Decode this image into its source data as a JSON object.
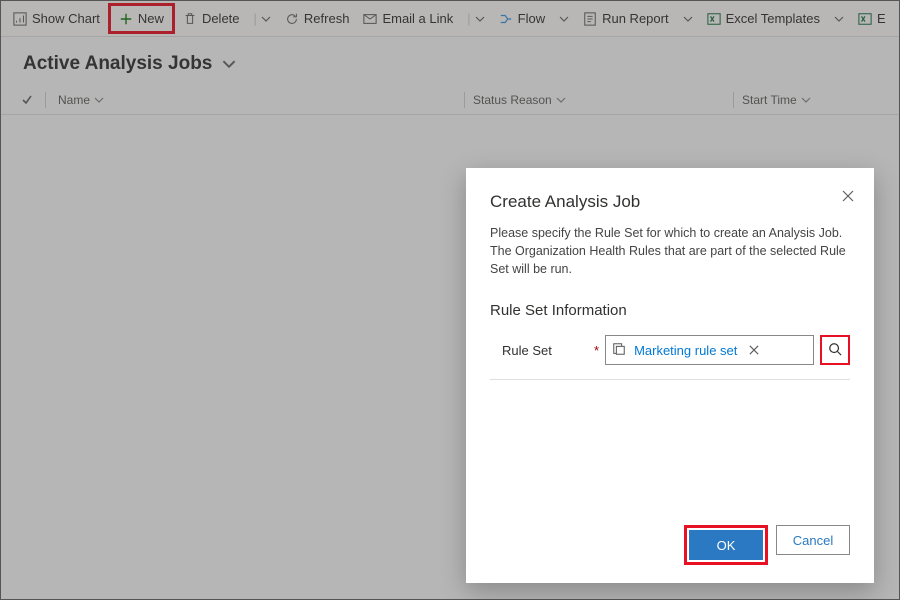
{
  "toolbar": {
    "show_chart": "Show Chart",
    "new": "New",
    "delete": "Delete",
    "refresh": "Refresh",
    "email_link": "Email a Link",
    "flow": "Flow",
    "run_report": "Run Report",
    "excel_templates": "Excel Templates",
    "excel_trunc": "E"
  },
  "view": {
    "title": "Active Analysis Jobs"
  },
  "columns": {
    "name": "Name",
    "status_reason": "Status Reason",
    "start_time": "Start Time"
  },
  "dialog": {
    "title": "Create Analysis Job",
    "description": "Please specify the Rule Set for which to create an Analysis Job. The Organization Health Rules that are part of the selected Rule Set will be run.",
    "section": "Rule Set Information",
    "field_label": "Rule Set",
    "selected_value": "Marketing rule set",
    "ok": "OK",
    "cancel": "Cancel"
  }
}
